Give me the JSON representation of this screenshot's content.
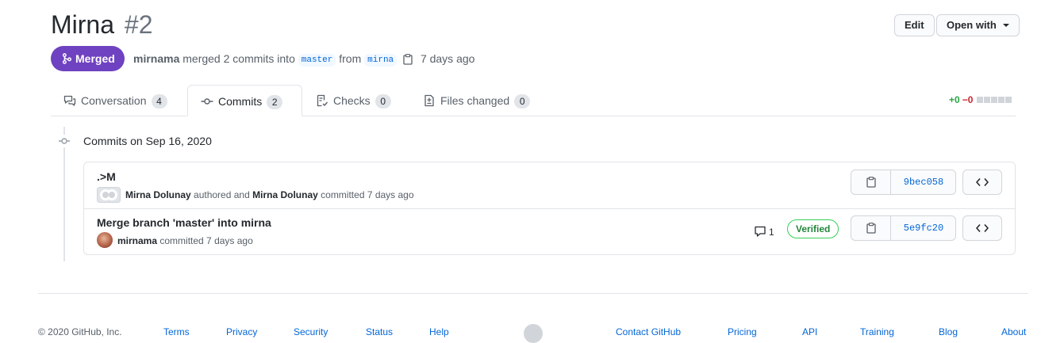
{
  "header": {
    "title": "Mirna",
    "number": "#2",
    "edit_label": "Edit",
    "open_with_label": "Open with"
  },
  "status": {
    "badge": "Merged",
    "author": "mirnama",
    "action": "merged 2 commits into",
    "base_branch": "master",
    "from_word": "from",
    "head_branch": "mirna",
    "time": "7 days ago"
  },
  "tabs": [
    {
      "label": "Conversation",
      "count": "4",
      "icon": "comment-discussion-icon"
    },
    {
      "label": "Commits",
      "count": "2",
      "icon": "git-commit-icon"
    },
    {
      "label": "Checks",
      "count": "0",
      "icon": "checklist-icon"
    },
    {
      "label": "Files changed",
      "count": "0",
      "icon": "file-diff-icon"
    }
  ],
  "diffstat": {
    "additions": "+0",
    "deletions": "−0"
  },
  "commits_group": {
    "date_label": "Commits on Sep 16, 2020",
    "commits": [
      {
        "title": ".>M",
        "author": "Mirna Dolunay",
        "authored_text": "authored and",
        "committer": "Mirna Dolunay",
        "committed_text": "committed 7 days ago",
        "sha": "9bec058"
      },
      {
        "title": "Merge branch 'master' into mirna",
        "author": "mirnama",
        "committed_text": "committed 7 days ago",
        "comments": "1",
        "verified": "Verified",
        "sha": "5e9fc20"
      }
    ]
  },
  "footer": {
    "copyright": "© 2020 GitHub, Inc.",
    "links_left": [
      "Terms",
      "Privacy",
      "Security",
      "Status",
      "Help"
    ],
    "links_right": [
      "Contact GitHub",
      "Pricing",
      "API",
      "Training",
      "Blog",
      "About"
    ]
  },
  "colors": {
    "merged": "#6f42c1",
    "link": "#0366d6",
    "additions": "#28a745",
    "deletions": "#cb2431",
    "verified": "#22863a"
  }
}
